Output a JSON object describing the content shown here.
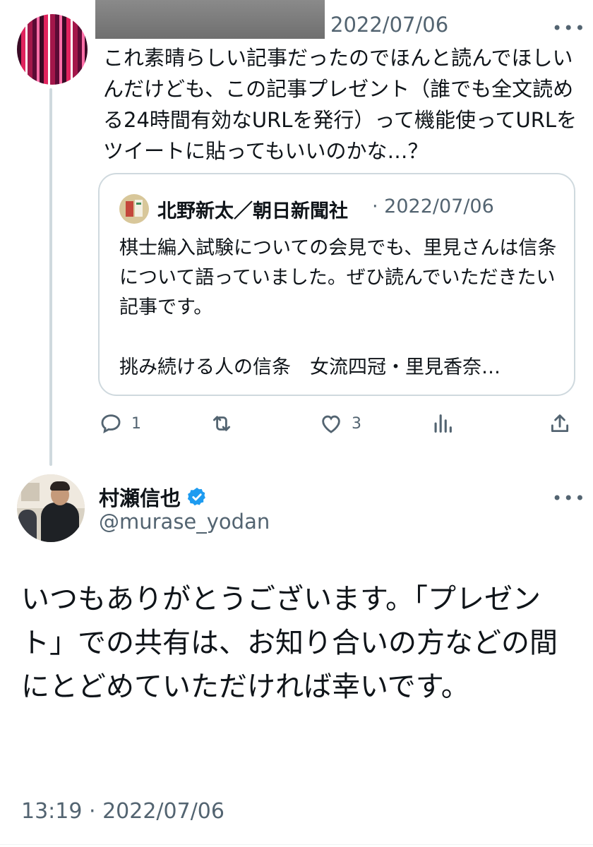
{
  "parent_tweet": {
    "date": "2022/07/06",
    "text": "これ素晴らしい記事だったのでほんと読んでほしいんだけども、この記事プレゼント（誰でも全文読める24時間有効なURLを発行）って機能使ってURLをツイートに貼ってもいいのかな…？",
    "quote": {
      "author": "北野新太／朝日新聞社",
      "date": "· 2022/07/06",
      "text": "棋士編入試験についての会見でも、里見さんは信条について語っていました。ぜひ読んでいただきたい記事です。",
      "headline": "挑み続ける人の信条　女流四冠・里見香奈…"
    },
    "actions": {
      "reply_icon": "reply-icon",
      "reply_count": "1",
      "retweet_icon": "retweet-icon",
      "like_icon": "heart-icon",
      "like_count": "3",
      "views_icon": "views-icon",
      "share_icon": "share-icon"
    }
  },
  "reply_tweet": {
    "display_name": "村瀬信也",
    "verified": true,
    "handle": "@murase_yodan",
    "text": "いつもありがとうございます。「プレゼント」での共有は、お知り合いの方などの間にとどめていただければ幸いです。",
    "meta": "13:19 · 2022/07/06"
  },
  "colors": {
    "text_primary": "#0f1419",
    "text_secondary": "#536471",
    "border": "#cfd9de",
    "verified_blue": "#1d9bf0"
  }
}
